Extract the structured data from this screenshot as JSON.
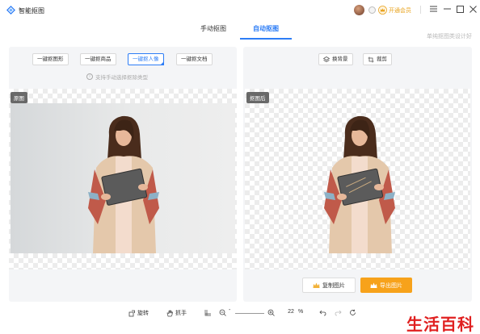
{
  "app": {
    "title": "智能抠图",
    "vip_label": "开通会员"
  },
  "tabs": [
    {
      "label": "手动抠图",
      "active": false
    },
    {
      "label": "自动抠图",
      "active": true
    }
  ],
  "hint_right": "单纯抠图类设计好",
  "left_panel": {
    "mode_buttons": [
      {
        "label": "一键抠图形",
        "active": false
      },
      {
        "label": "一键抠商品",
        "active": false
      },
      {
        "label": "一键抠人像",
        "active": true
      },
      {
        "label": "一键抠文档",
        "active": false
      }
    ],
    "mode_hint": "支持手动选择抠除类型",
    "tag": "原图"
  },
  "right_panel": {
    "tools": [
      {
        "label": "换背景",
        "icon": "layers-icon"
      },
      {
        "label": "裁剪",
        "icon": "crop-icon"
      }
    ],
    "tag": "抠图后",
    "copy_label": "复制图片",
    "download_label": "导出图片"
  },
  "bottom_bar": {
    "rotate_label": "旋转",
    "hand_label": "抓手",
    "zoom_value": "22",
    "zoom_unit": "%"
  },
  "watermark": "生活百科",
  "colors": {
    "accent": "#2d7df6",
    "download": "#f7a21b",
    "vip": "#e8a21b",
    "watermark": "#e02020"
  }
}
